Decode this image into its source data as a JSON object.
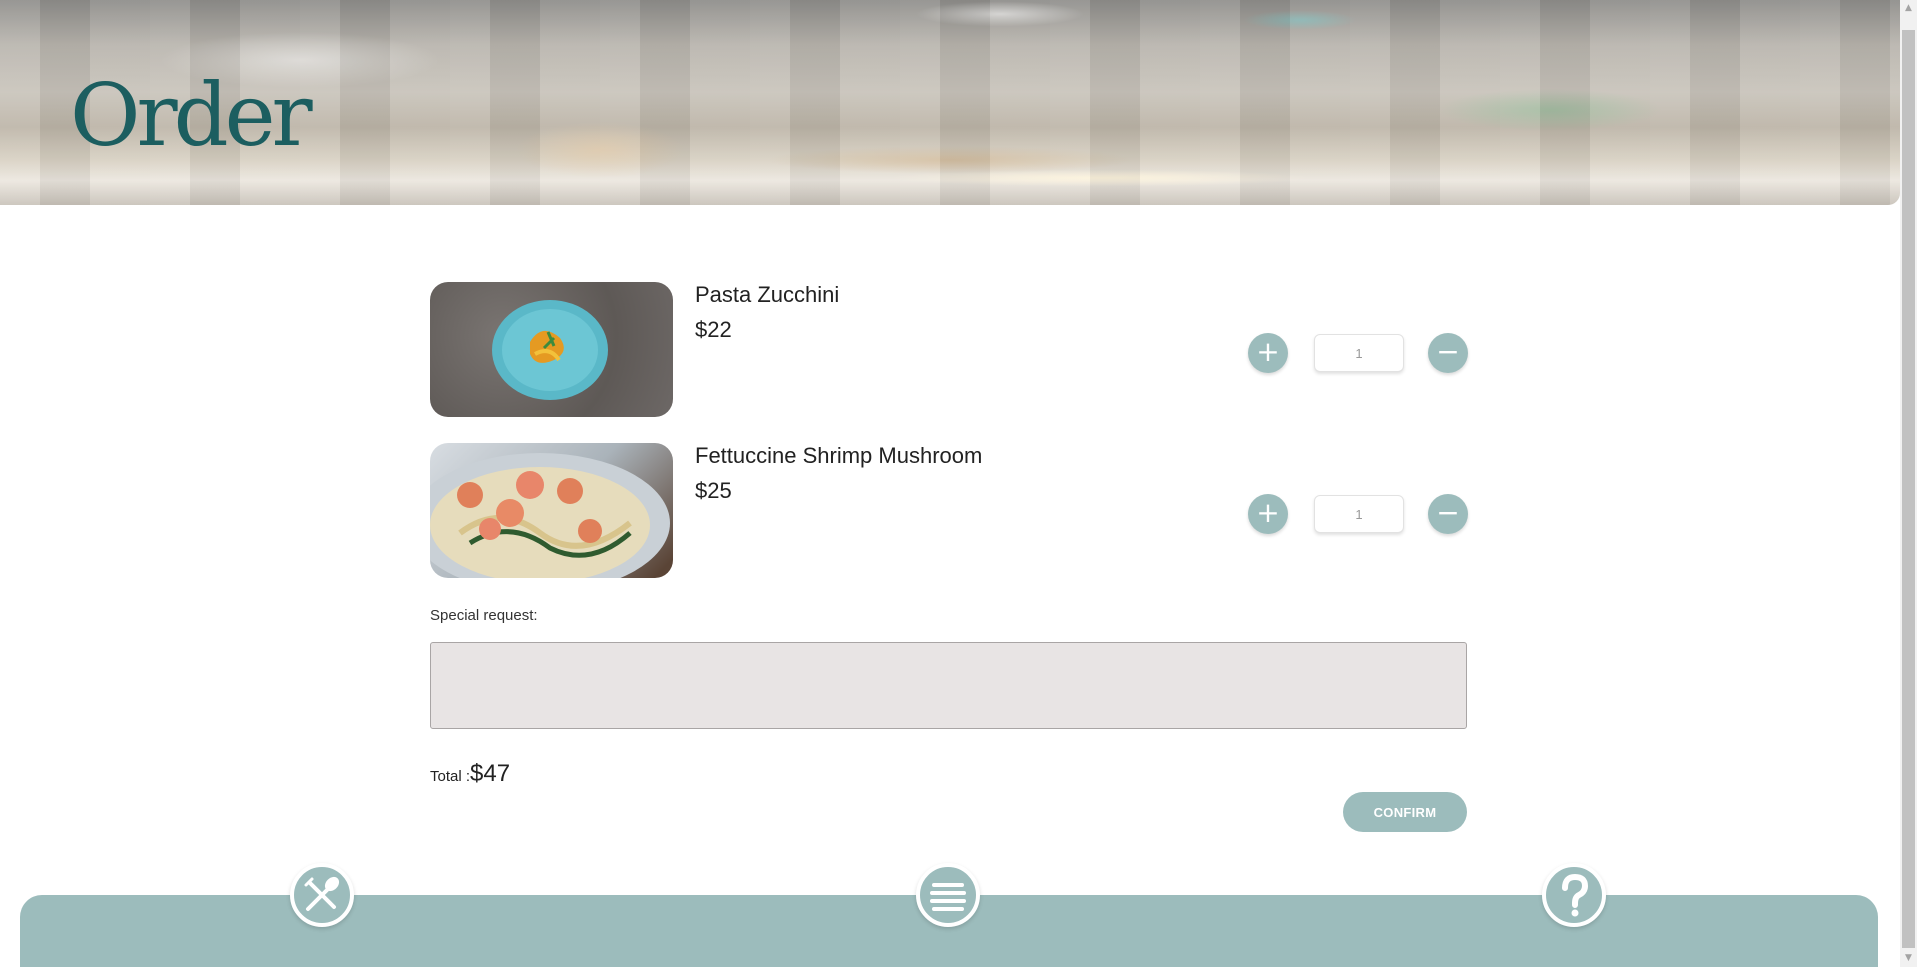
{
  "header": {
    "title": "Order"
  },
  "items": [
    {
      "name": "Pasta Zucchini",
      "price": "$22",
      "quantity": "1"
    },
    {
      "name": "Fettuccine Shrimp Mushroom",
      "price": "$25",
      "quantity": "1"
    }
  ],
  "controls": {
    "plus_symbol": "+",
    "minus_symbol": "−"
  },
  "special_request": {
    "label": "Special request:",
    "value": ""
  },
  "total": {
    "label": "Total :",
    "value": "$47"
  },
  "confirm": {
    "label": "CONFIRM"
  },
  "footer_nav": [
    {
      "icon": "fork-spoon-icon"
    },
    {
      "icon": "menu-icon"
    },
    {
      "icon": "help-icon"
    }
  ],
  "colors": {
    "accent": "#9cbcbc",
    "title": "#1c5e60",
    "request_box": "#e8e4e4"
  }
}
